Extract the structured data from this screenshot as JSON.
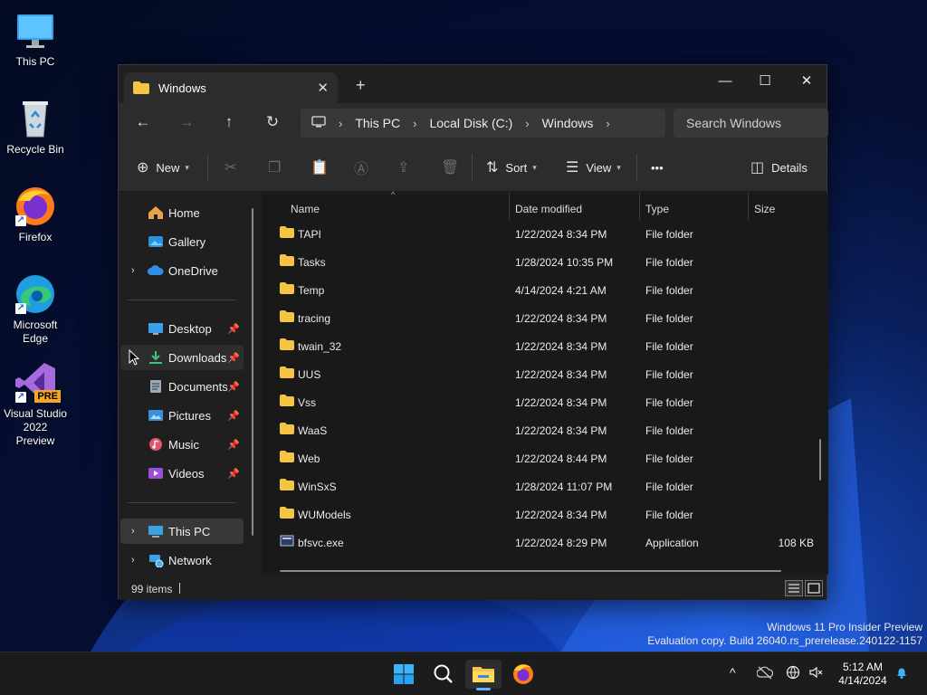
{
  "desktop": {
    "icons": [
      {
        "label": "This PC"
      },
      {
        "label": "Recycle Bin"
      },
      {
        "label": "Firefox"
      },
      {
        "label": "Microsoft Edge"
      },
      {
        "label": "Visual Studio 2022 Preview",
        "badge": "PRE"
      }
    ]
  },
  "window": {
    "tab_title": "Windows",
    "tab_close": "✕",
    "new_tab": "+",
    "controls": {
      "minimize": "—",
      "maximize": "☐",
      "close": "✕"
    },
    "nav": {
      "back": "←",
      "forward": "→",
      "up": "↑",
      "refresh": "↻"
    },
    "breadcrumb": [
      "This PC",
      "Local Disk (C:)",
      "Windows"
    ],
    "search_placeholder": "Search Windows",
    "toolbar": {
      "new_label": "New",
      "sort_label": "Sort",
      "view_label": "View",
      "more": "•••",
      "details_label": "Details"
    },
    "sidebar": {
      "items": [
        {
          "label": "Home"
        },
        {
          "label": "Gallery"
        },
        {
          "label": "OneDrive"
        },
        {
          "label": "Desktop"
        },
        {
          "label": "Downloads"
        },
        {
          "label": "Documents"
        },
        {
          "label": "Pictures"
        },
        {
          "label": "Music"
        },
        {
          "label": "Videos"
        },
        {
          "label": "This PC"
        },
        {
          "label": "Network"
        }
      ]
    },
    "columns": {
      "name": "Name",
      "date": "Date modified",
      "type": "Type",
      "size": "Size"
    },
    "rows": [
      {
        "name": "TAPI",
        "date": "1/22/2024 8:34 PM",
        "type": "File folder",
        "size": ""
      },
      {
        "name": "Tasks",
        "date": "1/28/2024 10:35 PM",
        "type": "File folder",
        "size": ""
      },
      {
        "name": "Temp",
        "date": "4/14/2024 4:21 AM",
        "type": "File folder",
        "size": ""
      },
      {
        "name": "tracing",
        "date": "1/22/2024 8:34 PM",
        "type": "File folder",
        "size": ""
      },
      {
        "name": "twain_32",
        "date": "1/22/2024 8:34 PM",
        "type": "File folder",
        "size": ""
      },
      {
        "name": "UUS",
        "date": "1/22/2024 8:34 PM",
        "type": "File folder",
        "size": ""
      },
      {
        "name": "Vss",
        "date": "1/22/2024 8:34 PM",
        "type": "File folder",
        "size": ""
      },
      {
        "name": "WaaS",
        "date": "1/22/2024 8:34 PM",
        "type": "File folder",
        "size": ""
      },
      {
        "name": "Web",
        "date": "1/22/2024 8:44 PM",
        "type": "File folder",
        "size": ""
      },
      {
        "name": "WinSxS",
        "date": "1/28/2024 11:07 PM",
        "type": "File folder",
        "size": ""
      },
      {
        "name": "WUModels",
        "date": "1/22/2024 8:34 PM",
        "type": "File folder",
        "size": ""
      },
      {
        "name": "bfsvc.exe",
        "date": "1/22/2024 8:29 PM",
        "type": "Application",
        "size": "108 KB"
      }
    ],
    "status_count": "99 items"
  },
  "watermark": {
    "line1": "Windows 11 Pro Insider Preview",
    "line2": "Evaluation copy. Build 26040.rs_prerelease.240122-1157"
  },
  "taskbar": {
    "time": "5:12 AM",
    "date": "4/14/2024",
    "tray_chevron": "^"
  },
  "colors": {
    "accent": "#5fb2ff",
    "folder": "#f4c542",
    "window_bg": "#1f1f1f"
  }
}
